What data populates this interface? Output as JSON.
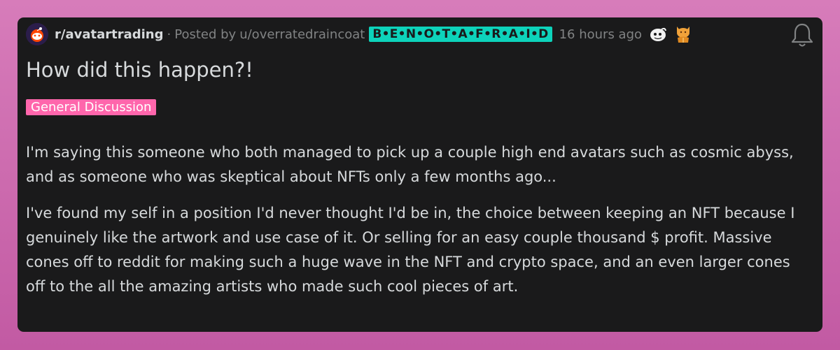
{
  "post": {
    "subreddit": "r/avatartrading",
    "separator": "·",
    "posted_by_prefix": "Posted by",
    "author": "u/overratedraincoat",
    "user_flair": "B•E•N•O•T•A•F•R•A•I•D",
    "time": "16 hours ago",
    "title": "How did this happen?!",
    "post_flair": "General Discussion",
    "paragraphs": [
      "I'm saying this someone who both managed to pick up a couple high end avatars such as cosmic abyss, and as someone who was skeptical about NFTs only a few months ago...",
      "I've found my self in a position I'd never thought I'd be in, the choice between keeping an NFT because I genuinely like the artwork and use case of it. Or selling for an easy couple thousand $ profit. Massive cones off to reddit for making such a huge wave in the NFT and crypto space, and an even larger cones off to the all the amazing artists who made such cool pieces of art."
    ],
    "awards": [
      "white-snoo-award-icon",
      "cat-award-icon"
    ]
  },
  "colors": {
    "background": "#d77cba",
    "card": "#1a1a1b",
    "text": "#d7dadc",
    "meta": "#818384",
    "user_flair_bg": "#0dd3bb",
    "post_flair_bg": "#ff66ac"
  }
}
